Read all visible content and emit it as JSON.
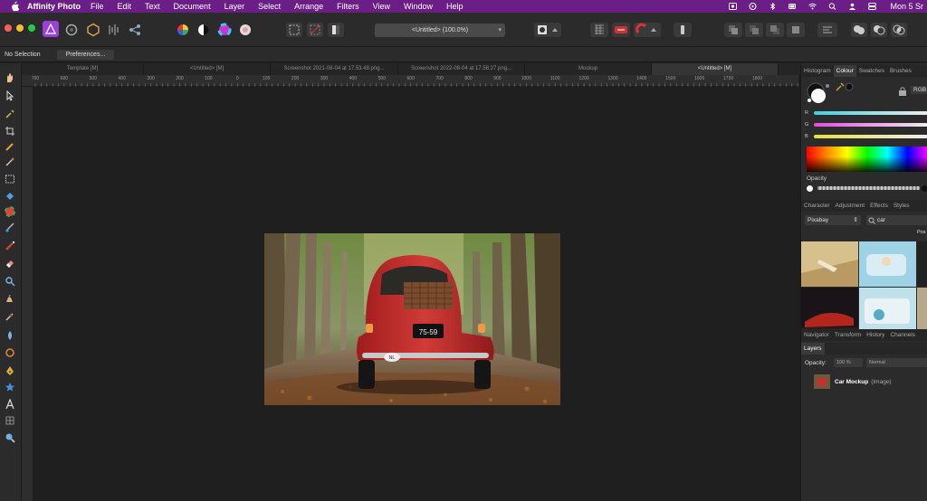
{
  "menubar": {
    "app_name": "Affinity Photo",
    "items": [
      "File",
      "Edit",
      "Text",
      "Document",
      "Layer",
      "Select",
      "Arrange",
      "Filters",
      "View",
      "Window",
      "Help"
    ],
    "clock": "Mon 5 Sr"
  },
  "toolbar": {
    "document_title": "<Untitled> (100.0%)"
  },
  "context": {
    "selection": "No Selection",
    "preferences": "Preferences..."
  },
  "tabs": [
    "Template [M]",
    "<Untitled> [M]",
    "Screenshot 2021-08-04 at 17.53.48.png...",
    "Screenshot 2022-08-04 at 17.58.27.png...",
    "Mockup",
    "<Untitled> [M]"
  ],
  "ruler_labels": [
    "700",
    "600",
    "500",
    "400",
    "300",
    "200",
    "100",
    "0",
    "100",
    "200",
    "300",
    "400",
    "500",
    "600",
    "700",
    "800",
    "900",
    "1000",
    "1100",
    "1200",
    "1300",
    "1400",
    "1500",
    "1600",
    "1700",
    "1800"
  ],
  "colour_panel": {
    "tabs": [
      "Histogram",
      "Colour",
      "Swatches",
      "Brushes"
    ],
    "mode": "RGB",
    "r_label": "R",
    "g_label": "G",
    "b_label": "B",
    "opacity_label": "Opacity"
  },
  "studio_tabs": [
    "Character",
    "Adjustment",
    "Effects",
    "Styles"
  ],
  "stock": {
    "source": "Pixabay",
    "query": "car",
    "extra": "Pos"
  },
  "nav_tabs": [
    "Navigator",
    "Transform",
    "History",
    "Channels"
  ],
  "layers": {
    "title": "Layers",
    "opacity_label": "Opacity:",
    "opacity_value": "100 %",
    "blend_mode": "Normal",
    "items": [
      {
        "name": "Car Mockup",
        "type": "(Image)"
      }
    ]
  },
  "photo": {
    "plate": "75-59",
    "badge": "NL"
  },
  "colors": {
    "menubar": "#6a1e86",
    "accent": "#9b3fd8"
  }
}
